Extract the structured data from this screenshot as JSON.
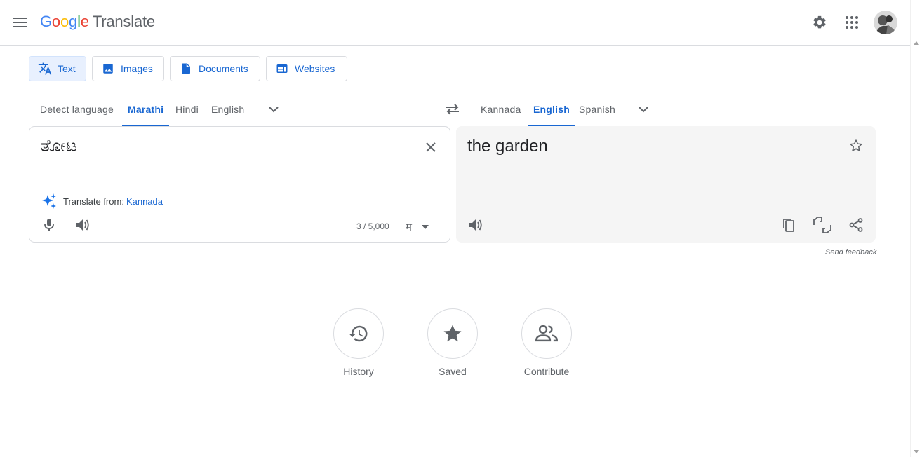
{
  "header": {
    "logo_letters": [
      "G",
      "o",
      "o",
      "g",
      "l",
      "e"
    ],
    "product_name": "Translate",
    "settings_icon": "gear-icon",
    "apps_icon": "apps-grid-icon"
  },
  "modes": [
    {
      "label": "Text",
      "icon": "translate-icon",
      "active": true
    },
    {
      "label": "Images",
      "icon": "image-icon",
      "active": false
    },
    {
      "label": "Documents",
      "icon": "document-icon",
      "active": false
    },
    {
      "label": "Websites",
      "icon": "website-icon",
      "active": false
    }
  ],
  "source_langs": [
    "Detect language",
    "Marathi",
    "Hindi",
    "English"
  ],
  "source_active": "Marathi",
  "target_langs": [
    "Kannada",
    "English",
    "Spanish"
  ],
  "target_active": "English",
  "source": {
    "text": "ತೋಟ",
    "translate_from_label": "Translate from:",
    "translate_from_lang": "Kannada",
    "char_count": "3 / 5,000",
    "ime_char": "म"
  },
  "target": {
    "text": "the garden",
    "send_feedback": "Send feedback"
  },
  "bottom": [
    {
      "label": "History",
      "icon": "history-icon"
    },
    {
      "label": "Saved",
      "icon": "star-icon"
    },
    {
      "label": "Contribute",
      "icon": "people-icon"
    }
  ],
  "colors": {
    "accent": "#1967d2",
    "panel_bg": "#f5f5f5",
    "active_tab_bg": "#e8f0fe"
  }
}
